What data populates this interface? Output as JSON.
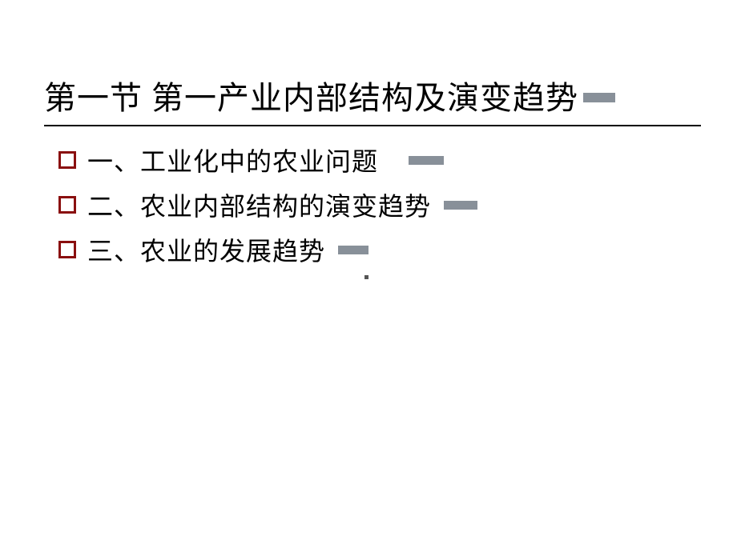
{
  "title": "第一节  第一产业内部结构及演变趋势",
  "bullets": [
    {
      "text": "一、工业化中的农业问题"
    },
    {
      "text": "二、农业内部结构的演变趋势"
    },
    {
      "text": "三、农业的发展趋势"
    }
  ]
}
